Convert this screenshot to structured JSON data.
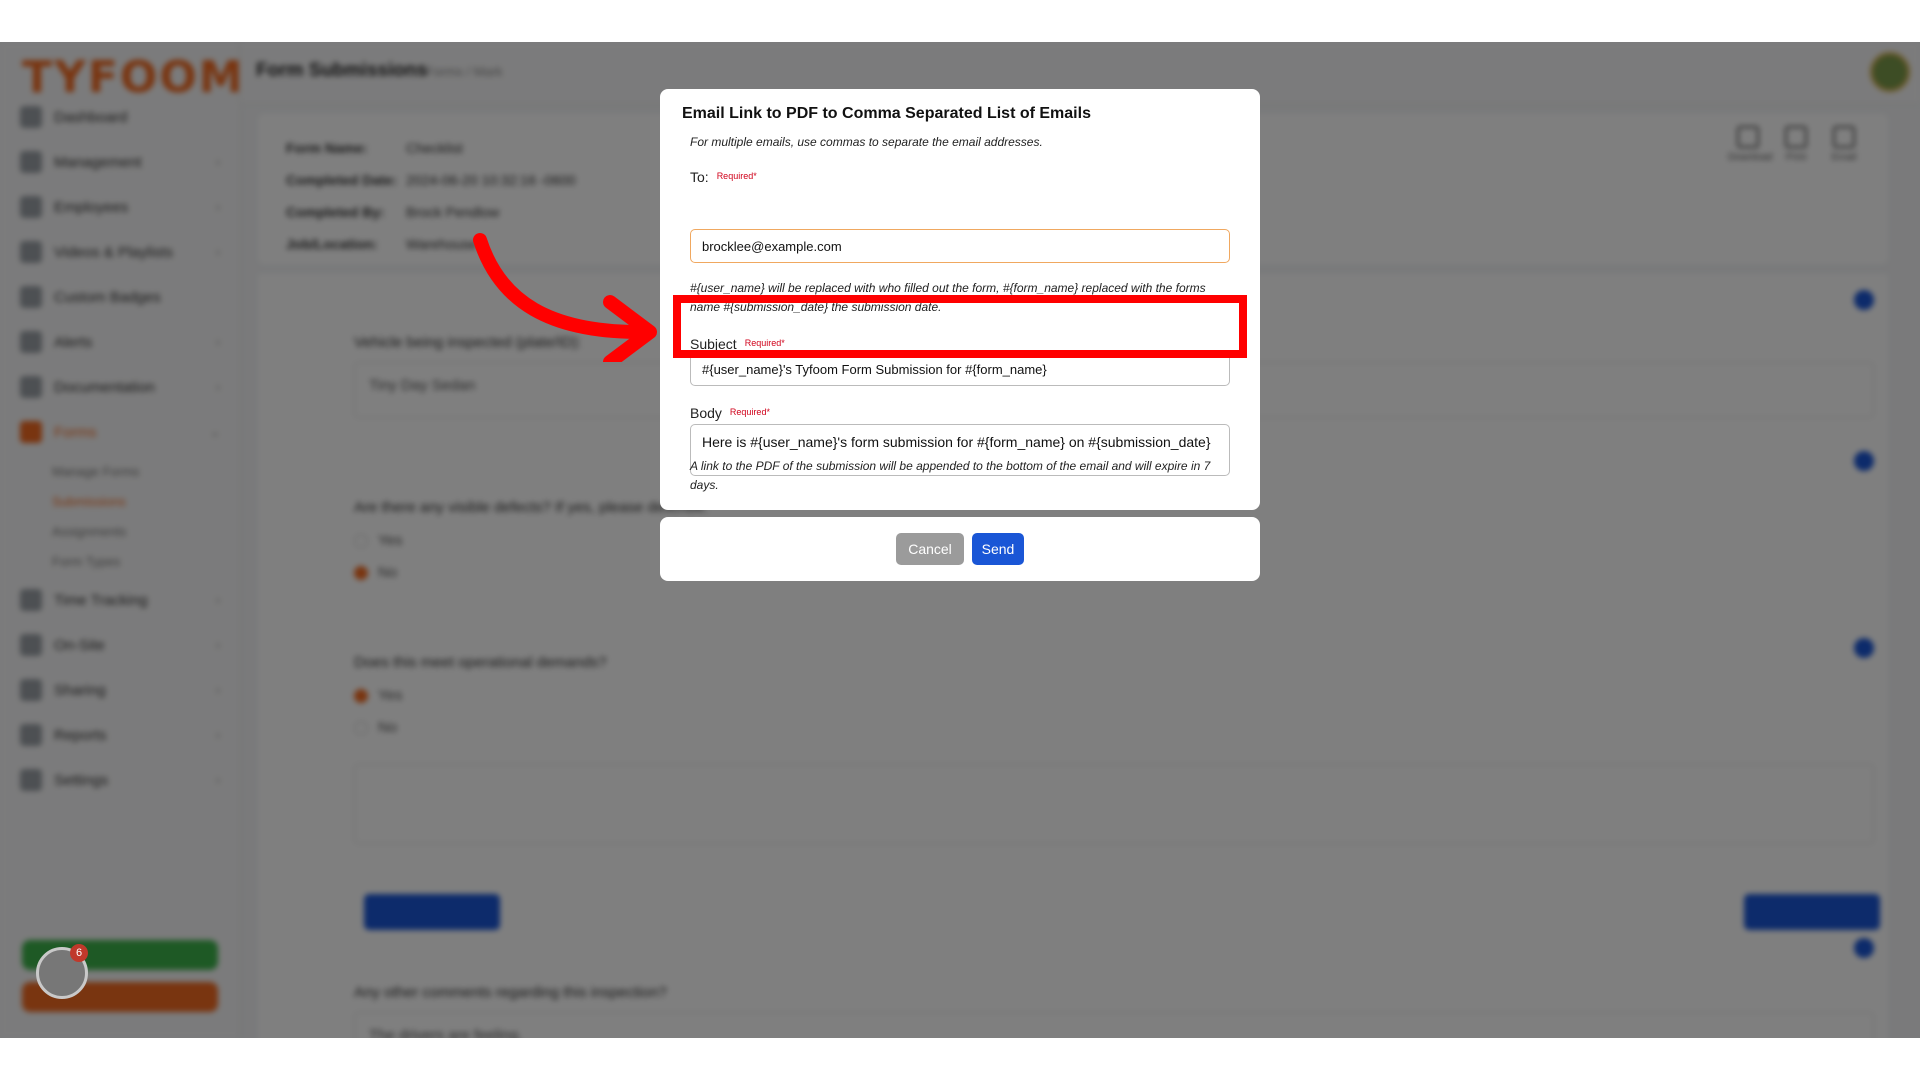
{
  "app": {
    "logo": "TYFOOM",
    "page_title": "Form Submissions",
    "breadcrumb": "Forms / Mark"
  },
  "sidebar": {
    "items": [
      {
        "label": "Dashboard",
        "icon": "dashboard-icon"
      },
      {
        "label": "Management",
        "icon": "building-icon"
      },
      {
        "label": "Employees",
        "icon": "person-icon"
      },
      {
        "label": "Videos & Playlists",
        "icon": "video-icon"
      },
      {
        "label": "Custom Badges",
        "icon": "badge-icon"
      },
      {
        "label": "Alerts",
        "icon": "bell-icon"
      },
      {
        "label": "Documentation",
        "icon": "document-icon"
      },
      {
        "label": "Forms",
        "icon": "form-icon"
      },
      {
        "label": "Time Tracking",
        "icon": "clock-icon"
      },
      {
        "label": "On-Site",
        "icon": "location-icon"
      },
      {
        "label": "Sharing",
        "icon": "share-icon"
      },
      {
        "label": "Reports",
        "icon": "chart-icon"
      },
      {
        "label": "Settings",
        "icon": "gear-icon"
      }
    ],
    "sub_items": [
      "Manage Forms",
      "Submissions",
      "Assignments",
      "Form Types"
    ]
  },
  "submission": {
    "form_name_label": "Form Name:",
    "form_name": "Checklist",
    "completed_date_label": "Completed Date:",
    "completed_date": "2024-06-20 10:32:16 -0600",
    "completed_by_label": "Completed By:",
    "completed_by": "Brock Pendlow",
    "jobs_label": "Job/Location:",
    "jobs": "Warehouse"
  },
  "header_actions": [
    {
      "label": "Download",
      "icon": "download-icon"
    },
    {
      "label": "Print",
      "icon": "print-icon"
    },
    {
      "label": "Email",
      "icon": "email-icon"
    }
  ],
  "questions": [
    {
      "text": "Vehicle being inspected (plate/ID):",
      "answer": "Tiny Day Sedan"
    },
    {
      "text": "Are there any visible defects? If yes, please describe.",
      "options": [
        "Yes",
        "No"
      ]
    },
    {
      "text": "Does this meet operational demands?",
      "options": [
        "Yes",
        "No"
      ]
    },
    {
      "text": "Any other comments regarding this inspection?",
      "answer": "The drivers are feeling."
    }
  ],
  "modal": {
    "title": "Email Link to PDF to Comma Separated List of Emails",
    "intro_hint": "For multiple emails, use commas to separate the email addresses.",
    "to_label": "To:",
    "required": "Required",
    "required_mark": "*",
    "to_value": "brocklee@example.com",
    "variables_hint": "#{user_name} will be replaced with who filled out the form, #{form_name} replaced with the forms name #{submission_date} the submission date.",
    "subject_label": "Subject",
    "subject_value": "#{user_name}'s Tyfoom Form Submission for #{form_name}",
    "body_label": "Body",
    "body_value": "Here is #{user_name}'s form submission for #{form_name} on #{submission_date}",
    "footer_hint": "A link to the PDF of the submission will be appended to the bottom of the email and will expire in 7 days.",
    "cancel_label": "Cancel",
    "send_label": "Send"
  },
  "widget": {
    "badge_count": "6"
  },
  "colors": {
    "brand": "#f26a21",
    "primary": "#1a56d6",
    "highlight": "#ff0000",
    "required": "#d0021b"
  }
}
